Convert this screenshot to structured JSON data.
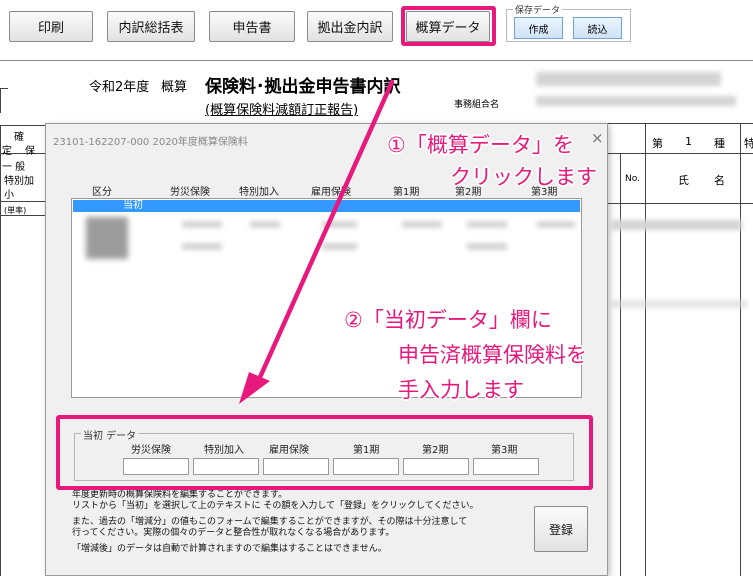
{
  "toolbar": {
    "print": "印刷",
    "breakdown_summary": "内訳総括表",
    "declaration": "申告書",
    "contribution_breakdown": "拠出金内訳",
    "estimate_data": "概算データ"
  },
  "saved_data": {
    "group_label": "保存データ",
    "create": "作成",
    "load": "読込"
  },
  "doc": {
    "year_label": "令和2年度",
    "estimate_label": "概算",
    "title": "保険料･拠出金申告書内訳",
    "subtitle": "(概算保険料減額訂正報告)",
    "union_label": "事務組合名",
    "left_labels": [
      "確",
      "定",
      "保",
      "一 般",
      "特別加",
      "小",
      "(単率)"
    ],
    "right_labels": [
      "第",
      "1",
      "種",
      "特",
      "No.",
      "氏",
      "名"
    ]
  },
  "dialog": {
    "title": "23101-162207-000 2020年度概算保険料",
    "close": "×",
    "columns": [
      "区分",
      "労災保険",
      "特別加入",
      "雇用保険",
      "第1期",
      "第2期",
      "第3期"
    ],
    "selected_row": "当初",
    "group_title": "当初 データ",
    "input_columns": [
      "労災保険",
      "特別加入",
      "雇用保険",
      "第1期",
      "第2期",
      "第3期"
    ],
    "info_lines": [
      "年度更新時の概算保険料を編集することができます。",
      "リストから「当初」を選択して上のテキストに その額を入力して「登録」をクリックしてください。",
      "また、過去の「増減分」の値もこのフォームで編集することができますが、その際は十分注意して",
      "行ってください。実際の個々のデータと整合性が取れなくなる場合があります。",
      "「増減後」のデータは自動で計算されますので編集はすることはできません。"
    ],
    "register": "登録"
  },
  "annotations": {
    "step1_line1": "①「概算データ」を",
    "step1_line2": "クリックします",
    "step2_line1": "②「当初データ」欄に",
    "step2_line2": "申告済概算保険料を",
    "step2_line3": "手入力します"
  },
  "colors": {
    "highlight": "#e8197d",
    "selection": "#3399ff"
  }
}
